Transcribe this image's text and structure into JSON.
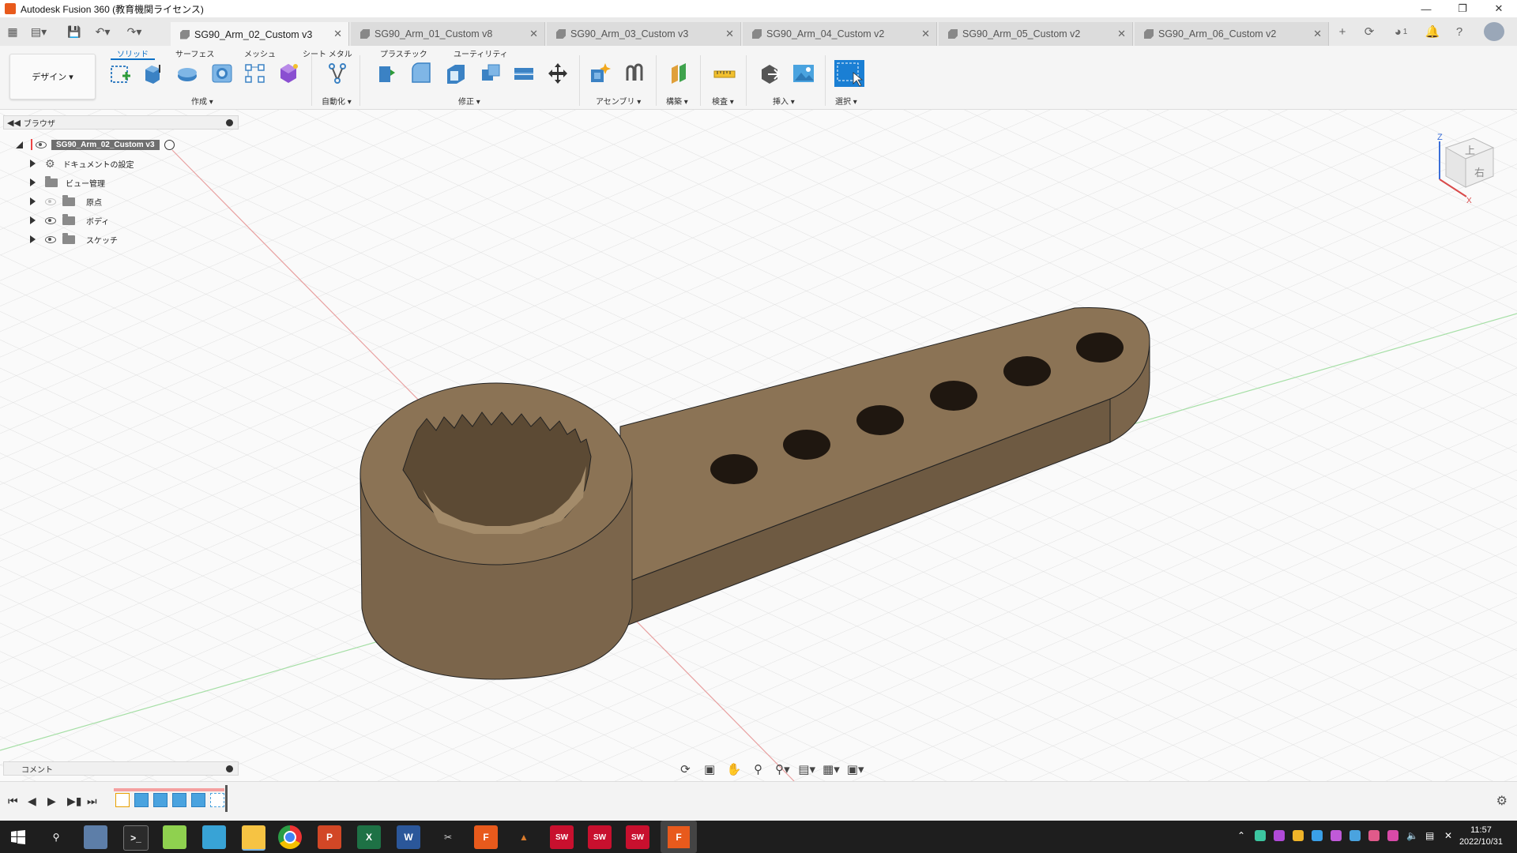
{
  "window": {
    "title": "Autodesk Fusion 360 (教育機関ライセンス)",
    "controls": [
      "minimize",
      "restore",
      "close"
    ]
  },
  "tabs": [
    {
      "label": "SG90_Arm_02_Custom v3",
      "active": true
    },
    {
      "label": "SG90_Arm_01_Custom v8",
      "active": false
    },
    {
      "label": "SG90_Arm_03_Custom v3",
      "active": false
    },
    {
      "label": "SG90_Arm_04_Custom v2",
      "active": false
    },
    {
      "label": "SG90_Arm_05_Custom v2",
      "active": false
    },
    {
      "label": "SG90_Arm_06_Custom v2",
      "active": false
    }
  ],
  "tabbar_right": {
    "job_count": "1"
  },
  "toolbar": {
    "workspace": "デザイン ▾",
    "menu_tabs": [
      "ソリッド",
      "サーフェス",
      "メッシュ",
      "シート メタル",
      "プラスチック",
      "ユーティリティ"
    ],
    "groups": [
      "作成 ▾",
      "自動化 ▾",
      "修正 ▾",
      "アセンブリ ▾",
      "構築 ▾",
      "検査 ▾",
      "挿入 ▾",
      "選択 ▾"
    ]
  },
  "browser": {
    "title": "ブラウザ",
    "root": "SG90_Arm_02_Custom v3",
    "items": [
      "ドキュメントの設定",
      "ビュー管理",
      "原点",
      "ボディ",
      "スケッチ"
    ]
  },
  "comment_panel": {
    "title": "コメント"
  },
  "viewcube": {
    "top_label": "上",
    "right_label": "右",
    "axis_z": "Z",
    "axis_x": "X"
  },
  "colors": {
    "body": "#8b7355",
    "body_dark": "#6e5a42",
    "body_light": "#a38b6a",
    "accent": "#0b6fc6"
  },
  "clock": {
    "time": "11:57",
    "date": "2022/10/31"
  },
  "taskbar_apps": [
    "Windows",
    "Search",
    "Explorer",
    "Terminal",
    "Notepad++",
    "Edge",
    "Files",
    "Chrome",
    "PowerPoint",
    "Excel",
    "Word",
    "Snipping",
    "Fusion 360",
    "MATLAB",
    "SolidWorks 2019",
    "SolidWorks 2020",
    "SolidWorks 2019",
    "Fusion 360"
  ]
}
